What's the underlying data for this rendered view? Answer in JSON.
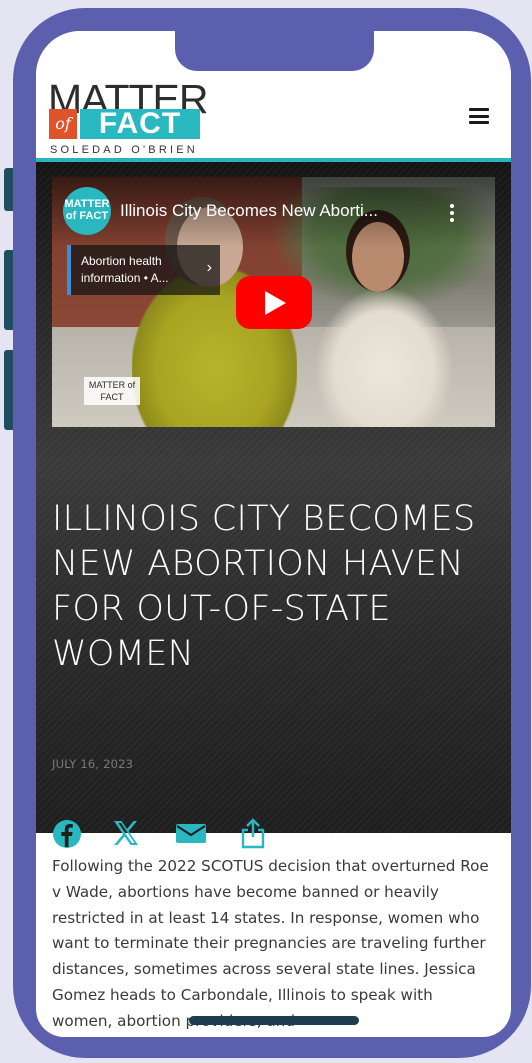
{
  "site": {
    "logo_matter": "MATTER",
    "logo_of": "of",
    "logo_fact": "FACT",
    "logo_byline": "SOLEDAD O'BRIEN"
  },
  "video": {
    "channel_avatar_text": "MATTER of FACT",
    "title": "Illinois City Becomes New Aborti...",
    "info_card": "Abortion health information • A...",
    "watermark_text": "MATTER of FACT"
  },
  "article": {
    "title": "ILLINOIS CITY BECOMES NEW ABORTION HAVEN FOR OUT-OF-STATE WOMEN",
    "date": "JULY 16, 2023",
    "body": "Following the 2022 SCOTUS decision that overturned Roe v Wade, abortions have become banned or heavily restricted in at least 14 states. In response, women who want to terminate their pregnancies are traveling further distances, sometimes across several state lines. Jessica Gomez heads to Carbondale, Illinois to speak with women, abortion providers, and"
  },
  "share": [
    "facebook-icon",
    "x-icon",
    "mail-icon",
    "share-icon"
  ],
  "colors": {
    "phone_frame": "#5b5fad",
    "accent_teal": "#29b8c0",
    "logo_orange": "#e0532a",
    "youtube_red": "#ff0000"
  }
}
